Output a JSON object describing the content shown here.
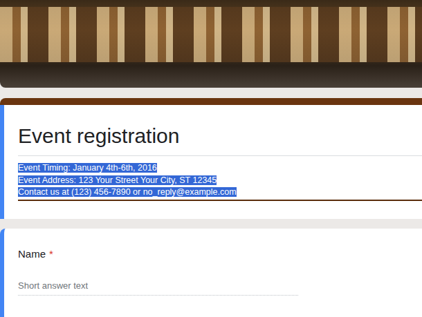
{
  "header_image": {
    "kind": "photo"
  },
  "form": {
    "title": "Event registration",
    "description": {
      "selected": true,
      "lines": [
        "Event Timing: January 4th-6th, 2016",
        "Event Address: 123 Your Street Your City, ST 12345",
        "Contact us at (123) 456-7890 or no_reply@example.com"
      ]
    }
  },
  "questions": [
    {
      "label": "Name",
      "required": true,
      "required_mark": "*",
      "placeholder": "Short answer text"
    }
  ]
}
